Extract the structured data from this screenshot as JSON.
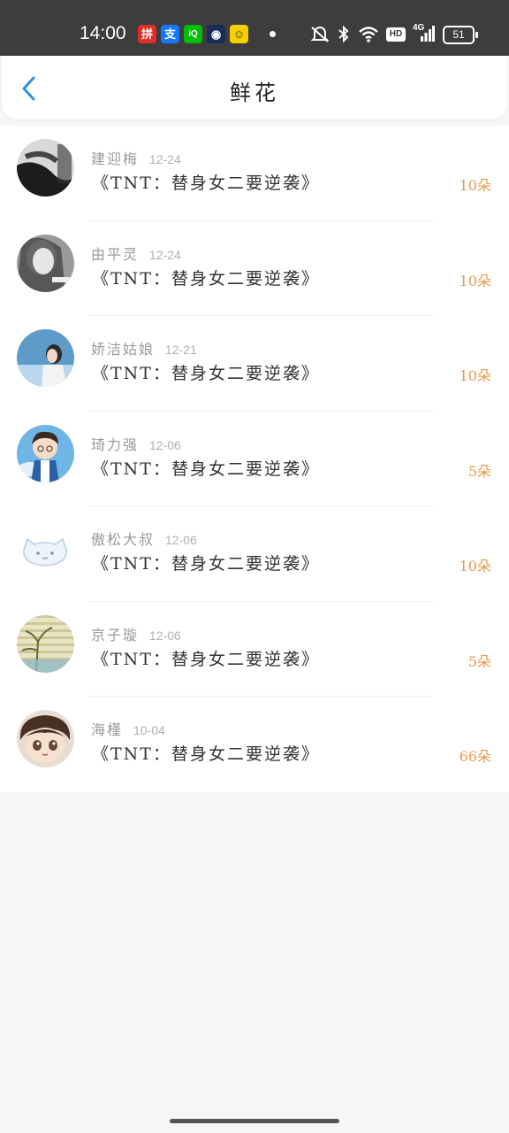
{
  "status_bar": {
    "time": "14:00",
    "apps": [
      {
        "icon": "pinduoduo-icon",
        "color": "#e02e24",
        "glyph": "拼"
      },
      {
        "icon": "alipay-icon",
        "color": "#1677ff",
        "glyph": "支"
      },
      {
        "icon": "iqiyi-icon",
        "color": "#00be06",
        "glyph": "iQ"
      },
      {
        "icon": "app-icon",
        "color": "#1a2b5a",
        "glyph": "◉"
      },
      {
        "icon": "app-yellow-icon",
        "color": "#f5d000",
        "glyph": "☺"
      }
    ],
    "battery": "51",
    "network": "4G",
    "hd_label": "HD"
  },
  "header": {
    "title": "鲜花"
  },
  "rows": [
    {
      "name": "建迎梅",
      "date": "12-24",
      "book": "《TNT：替身女二要逆袭》",
      "count": "10朵",
      "avatar": "dark"
    },
    {
      "name": "由平灵",
      "date": "12-24",
      "book": "《TNT：替身女二要逆袭》",
      "count": "10朵",
      "avatar": "gray"
    },
    {
      "name": "娇洁姑娘",
      "date": "12-21",
      "book": "《TNT：替身女二要逆袭》",
      "count": "10朵",
      "avatar": "sky"
    },
    {
      "name": "琦力强",
      "date": "12-06",
      "book": "《TNT：替身女二要逆袭》",
      "count": "5朵",
      "avatar": "cartoon"
    },
    {
      "name": "傲松大叔",
      "date": "12-06",
      "book": "《TNT：替身女二要逆袭》",
      "count": "10朵",
      "avatar": "cat"
    },
    {
      "name": "京子璇",
      "date": "12-06",
      "book": "《TNT：替身女二要逆袭》",
      "count": "5朵",
      "avatar": "tree"
    },
    {
      "name": "海槿",
      "date": "10-04",
      "book": "《TNT：替身女二要逆袭》",
      "count": "66朵",
      "avatar": "kid"
    }
  ]
}
